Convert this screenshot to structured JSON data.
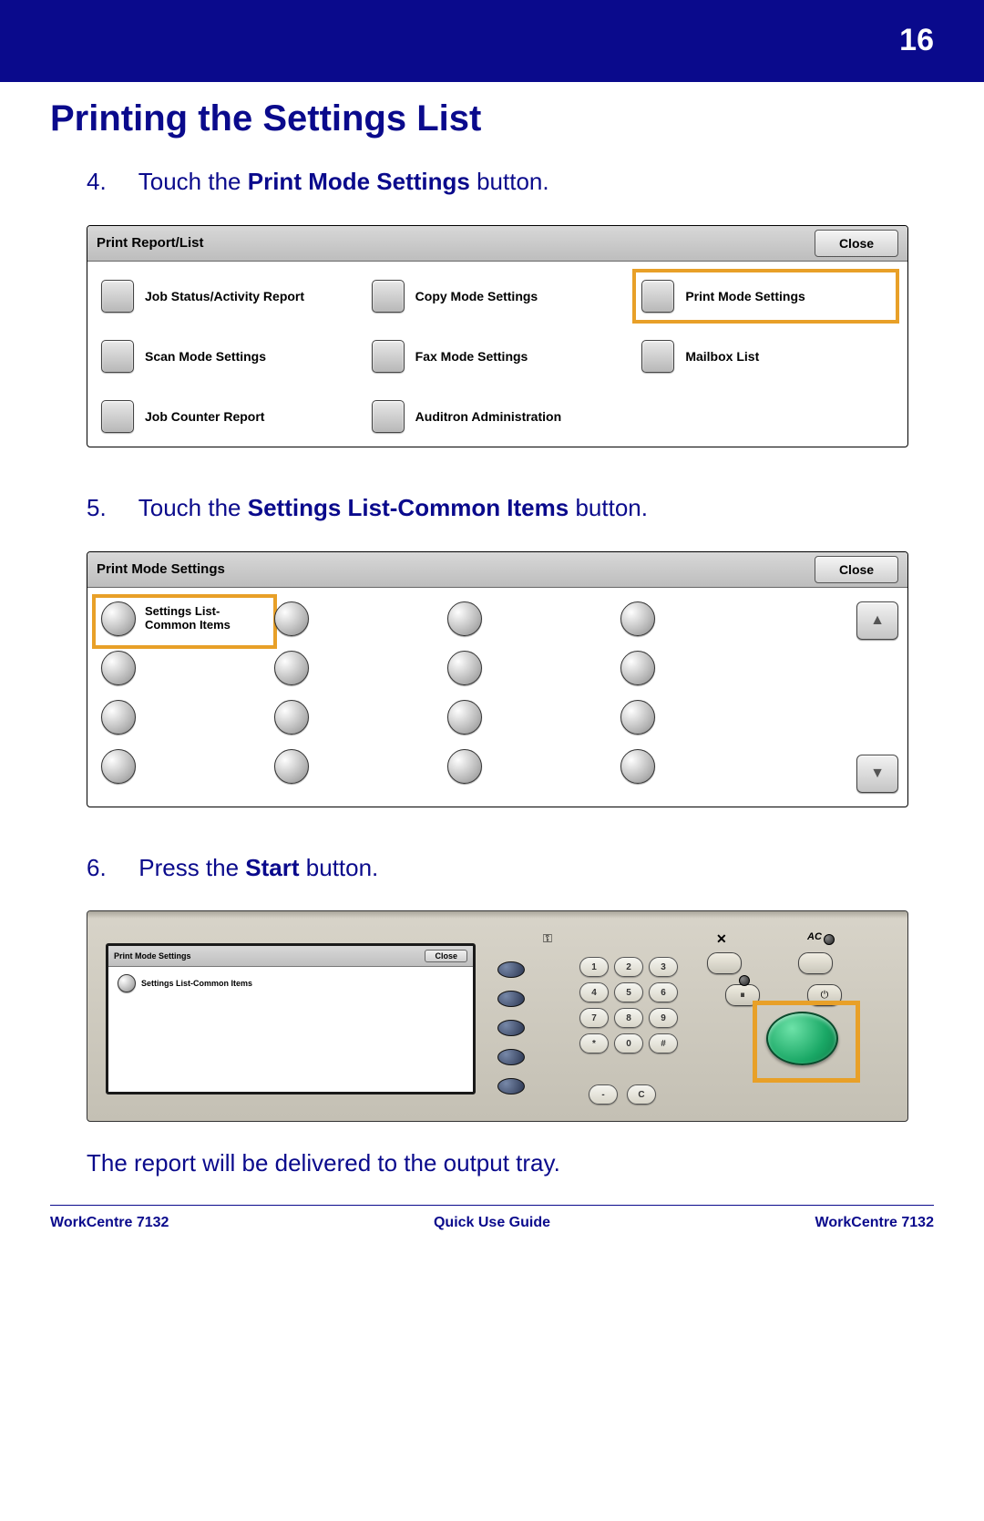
{
  "page_number": "16",
  "title": "Printing the Settings List",
  "steps": {
    "s4": {
      "num": "4.",
      "pre": "Touch the ",
      "bold": "Print Mode Settings",
      "post": " button."
    },
    "s5": {
      "num": "5.",
      "pre": "Touch the ",
      "bold": "Settings List-Common Items",
      "post": " button."
    },
    "s6": {
      "num": "6.",
      "pre": "Press the ",
      "bold": "Start",
      "post": " button."
    }
  },
  "result_text": "The report will be delivered to the output tray.",
  "panel1": {
    "title": "Print Report/List",
    "close": "Close",
    "options": [
      "Job Status/Activity Report",
      "Copy Mode Settings",
      "Print Mode Settings",
      "Scan Mode Settings",
      "Fax Mode Settings",
      "Mailbox List",
      "Job Counter Report",
      "Auditron Administration"
    ]
  },
  "panel2": {
    "title": "Print Mode Settings",
    "close": "Close",
    "option1": "Settings List-Common Items",
    "scroll_up": "▲",
    "scroll_down": "▼"
  },
  "device": {
    "screen_title": "Print Mode Settings",
    "screen_close": "Close",
    "screen_item": "Settings List-Common Items",
    "keypad": [
      "1",
      "2",
      "3",
      "4",
      "5",
      "6",
      "7",
      "8",
      "9",
      "*",
      "0",
      "#"
    ],
    "extra_keys": [
      "-",
      "C"
    ],
    "icon_key": "⚿",
    "icon_x": "✕",
    "icon_ac": "AC",
    "icon_pause": "⏸",
    "icon_power": "⏻"
  },
  "footer": {
    "left": "WorkCentre 7132",
    "center": "Quick Use Guide",
    "right": "WorkCentre 7132"
  }
}
